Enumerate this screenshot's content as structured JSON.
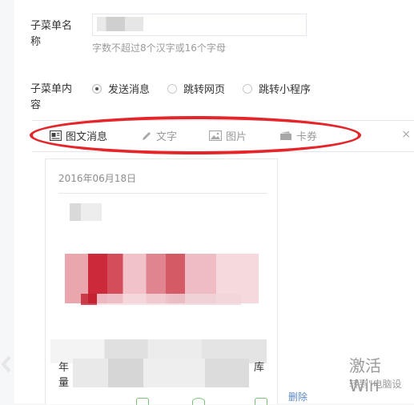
{
  "menu_name": {
    "label": "子菜单名称",
    "value": "",
    "hint": "字数不超过8个汉字或16个字母"
  },
  "menu_content": {
    "label": "子菜单内容",
    "options": [
      {
        "label": "发送消息",
        "checked": true
      },
      {
        "label": "跳转网页",
        "checked": false
      },
      {
        "label": "跳转小程序",
        "checked": false
      }
    ]
  },
  "tabs": [
    {
      "label": "图文消息",
      "icon": "news-icon",
      "active": true
    },
    {
      "label": "文字",
      "icon": "pen-icon",
      "active": false
    },
    {
      "label": "图片",
      "icon": "image-icon",
      "active": false
    },
    {
      "label": "卡券",
      "icon": "card-icon",
      "active": false
    }
  ],
  "close_symbol": "×",
  "article": {
    "date": "2016年06月18日",
    "row_prefix_1": "年",
    "row_prefix_2": "量",
    "row_suffix": "库"
  },
  "delete_label": "删除",
  "watermark": {
    "title": "激活 Win",
    "subtitle": "转到\"电脑设"
  },
  "colors": {
    "highlight": "#e5252a",
    "accent_blue": "#5b87c5"
  }
}
